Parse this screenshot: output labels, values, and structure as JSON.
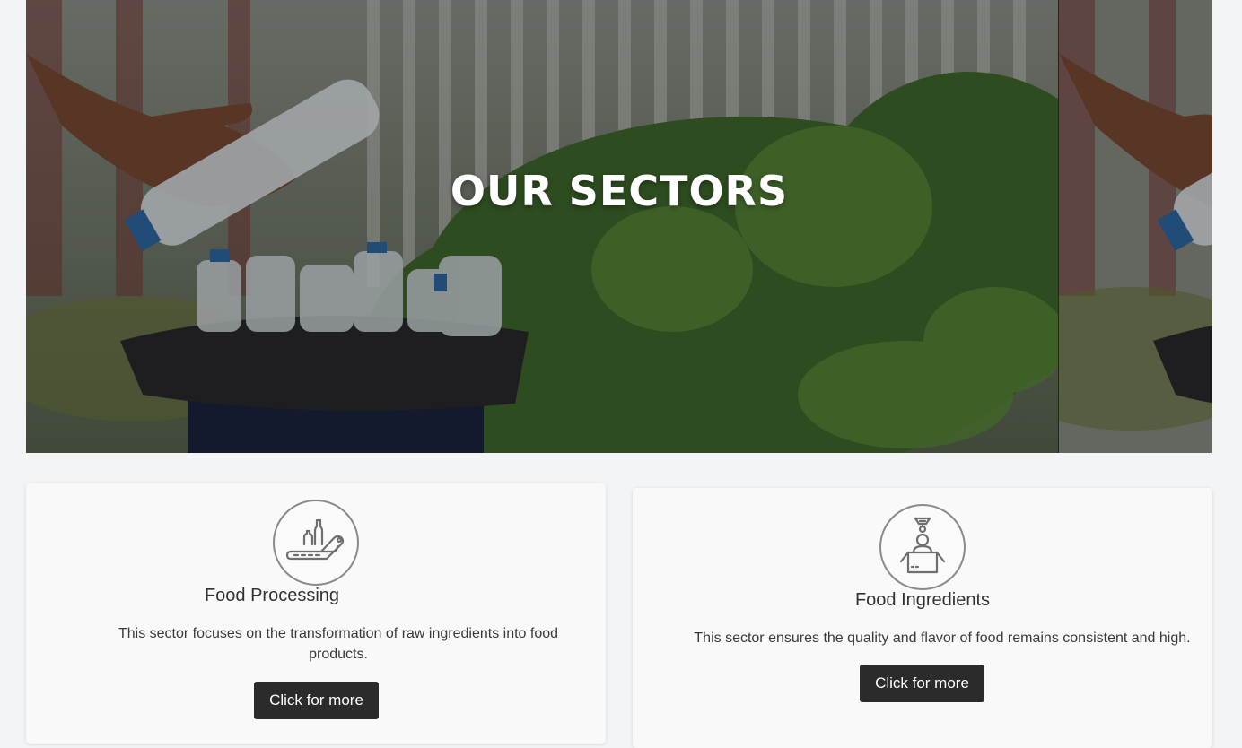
{
  "hero": {
    "title": "OUR SECTORS",
    "image_description_icon": "recycling-bottles-image"
  },
  "sectors": [
    {
      "icon": "bottle-conveyor-icon",
      "title": "Food Processing",
      "description": "This sector focuses on the transformation of raw ingredients into food products.",
      "button_label": "Click for more"
    },
    {
      "icon": "worker-quality-box-icon",
      "title": "Food Ingredients",
      "description": "This sector ensures the quality and flavor of food remains consistent and high.",
      "button_label": "Click for more"
    }
  ],
  "colors": {
    "page_background": "#f3f4f6",
    "card_background": "#f9f9f9",
    "button_background": "#2b2b2b",
    "button_text": "#ffffff",
    "icon_stroke": "#8a8a8a"
  }
}
